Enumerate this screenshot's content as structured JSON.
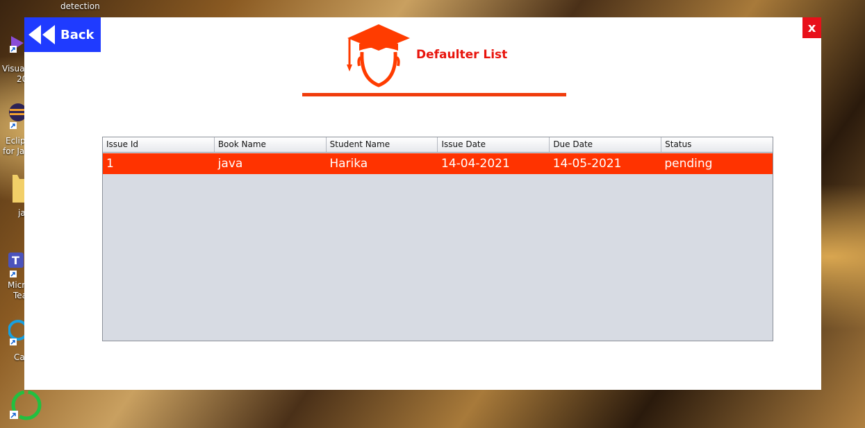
{
  "desktop": {
    "labels": [
      "detection",
      "Visual",
      "20",
      "Eclip",
      "for Jav",
      "ja",
      "Micr",
      "Tea",
      "Ca"
    ]
  },
  "window": {
    "back_label": "Back",
    "close_label": "x",
    "title": "Defaulter List"
  },
  "table": {
    "columns": [
      "Issue Id",
      "Book Name",
      "Student Name",
      "Issue Date",
      "Due Date",
      "Status"
    ],
    "rows": [
      [
        "1",
        "java",
        "Harika",
        "14-04-2021",
        "14-05-2021",
        "pending"
      ]
    ]
  },
  "colors": {
    "accent": "#ff3300",
    "back_button": "#1f3bff",
    "close_button": "#e8101a",
    "title": "#e8140c",
    "table_bg": "#d7dbe3"
  },
  "icons": [
    "rewind-icon",
    "graduate-icon",
    "close-icon"
  ]
}
